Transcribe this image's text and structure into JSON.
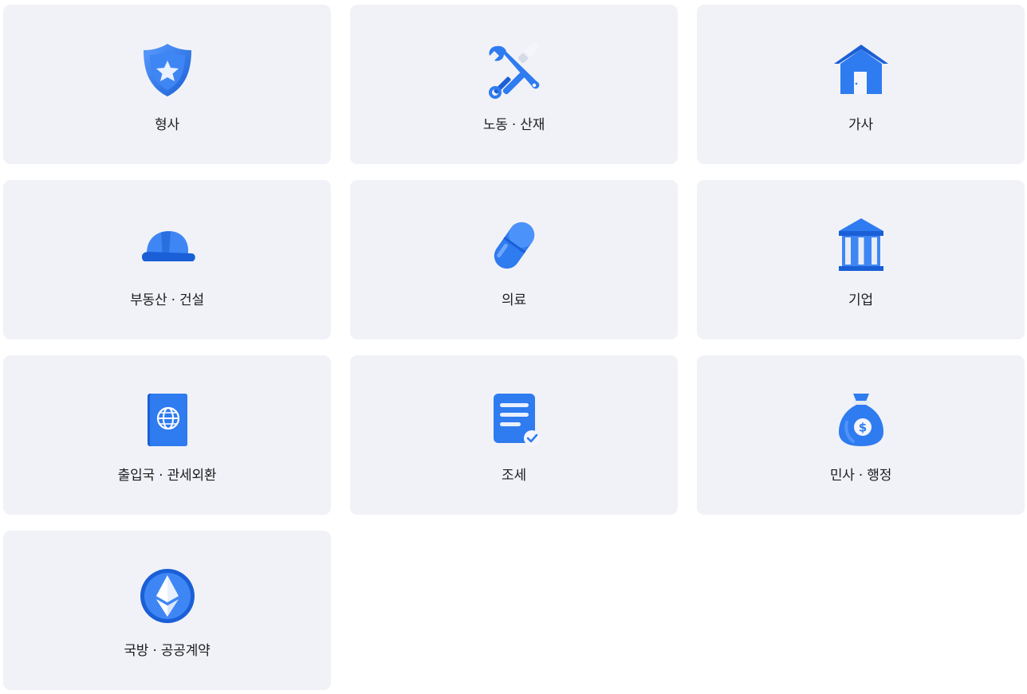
{
  "categories": [
    {
      "label": "형사",
      "icon": "shield-star-icon"
    },
    {
      "label": "노동 · 산재",
      "icon": "wrench-screwdriver-icon"
    },
    {
      "label": "가사",
      "icon": "house-icon"
    },
    {
      "label": "부동산 · 건설",
      "icon": "hard-hat-icon"
    },
    {
      "label": "의료",
      "icon": "pill-icon"
    },
    {
      "label": "기업",
      "icon": "bank-building-icon"
    },
    {
      "label": "출입국 · 관세외환",
      "icon": "passport-globe-icon"
    },
    {
      "label": "조세",
      "icon": "document-check-icon"
    },
    {
      "label": "민사 · 행정",
      "icon": "money-bag-icon"
    },
    {
      "label": "국방 · 공공계약",
      "icon": "ethereum-coin-icon"
    }
  ],
  "colors": {
    "card_background": "#f1f2f7",
    "icon_blue": "#2f7bf0",
    "icon_blue_dark": "#1a5fd6",
    "text": "#1d1d1f"
  }
}
